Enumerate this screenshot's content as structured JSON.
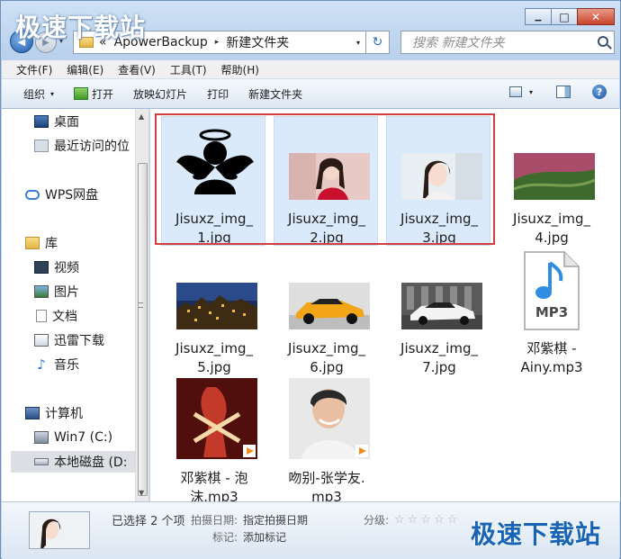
{
  "watermark": "极速下载站",
  "window": {
    "min_glyph": "▁",
    "max_glyph": "□",
    "close_glyph": "✕"
  },
  "navbar": {
    "back_glyph": "◀",
    "fwd_glyph": "▶",
    "recent_drop": "▾",
    "crumb_prefix": "«",
    "breadcrumb": [
      "ApowerBackup",
      "新建文件夹"
    ],
    "crumb_sep": "▸",
    "addr_drop": "▾",
    "refresh_glyph": "↻",
    "search_placeholder": "搜索 新建文件夹"
  },
  "menubar": [
    "文件(F)",
    "编辑(E)",
    "查看(V)",
    "工具(T)",
    "帮助(H)"
  ],
  "commandbar": {
    "organize": "组织",
    "open": "打开",
    "slideshow": "放映幻灯片",
    "print": "打印",
    "new_folder": "新建文件夹",
    "dropdown_glyph": "▾",
    "help_glyph": "?"
  },
  "navpane": {
    "items": [
      {
        "label": "桌面",
        "icon": "desktop-icon"
      },
      {
        "label": "最近访问的位",
        "icon": "recent-places-icon"
      },
      {
        "label": "WPS网盘",
        "icon": "cloud-icon"
      },
      {
        "label": "库",
        "icon": "library-icon"
      },
      {
        "label": "视频",
        "icon": "video-icon"
      },
      {
        "label": "图片",
        "icon": "pictures-icon"
      },
      {
        "label": "文档",
        "icon": "documents-icon"
      },
      {
        "label": "迅雷下载",
        "icon": "thunder-download-icon"
      },
      {
        "label": "音乐",
        "icon": "music-icon"
      },
      {
        "label": "计算机",
        "icon": "computer-icon"
      },
      {
        "label": "Win7 (C:)",
        "icon": "drive-c-icon"
      },
      {
        "label": "本地磁盘 (D:",
        "icon": "drive-icon"
      }
    ],
    "selected": "本地磁盘 (D:",
    "scroll_up": "▲",
    "scroll_down": "▼"
  },
  "files": [
    {
      "line1": "Jisuxz_img_",
      "line2": "1.jpg",
      "type": "image",
      "thumb": "angel-avatar",
      "selected": true
    },
    {
      "line1": "Jisuxz_img_",
      "line2": "2.jpg",
      "type": "image",
      "thumb": "portrait-red",
      "selected": true
    },
    {
      "line1": "Jisuxz_img_",
      "line2": "3.jpg",
      "type": "image",
      "thumb": "portrait-light",
      "selected": true
    },
    {
      "line1": "Jisuxz_img_",
      "line2": "4.jpg",
      "type": "image",
      "thumb": "aerial-forest",
      "selected": false
    },
    {
      "line1": "Jisuxz_img_",
      "line2": "5.jpg",
      "type": "image",
      "thumb": "night-town",
      "selected": false
    },
    {
      "line1": "Jisuxz_img_",
      "line2": "6.jpg",
      "type": "image",
      "thumb": "orange-car",
      "selected": false
    },
    {
      "line1": "Jisuxz_img_",
      "line2": "7.jpg",
      "type": "image",
      "thumb": "white-car",
      "selected": false
    },
    {
      "line1": "邓紫棋 -",
      "line2": "Ainy.mp3",
      "type": "audio",
      "thumb": "mp3-icon",
      "badge": "MP3",
      "selected": false
    },
    {
      "line1": "邓紫棋 - 泡",
      "line2": "沫.mp3",
      "type": "audio",
      "thumb": "album-red",
      "selected": false
    },
    {
      "line1": "吻别-张学友.",
      "line2": "mp3",
      "type": "audio",
      "thumb": "album-portrait",
      "selected": false
    }
  ],
  "details": {
    "selected_count": "已选择 2 个项",
    "date_key": "拍摄日期:",
    "date_val": "指定拍摄日期",
    "tags_key": "标记:",
    "tags_val": "添加标记",
    "rating_key": "分级:",
    "star_glyph": "☆",
    "rating": 0,
    "stars": 5
  },
  "colors": {
    "selection_fill": "#dbeafb",
    "highlight_border": "#d33f3f",
    "watermark_blue": "#1863b4"
  }
}
